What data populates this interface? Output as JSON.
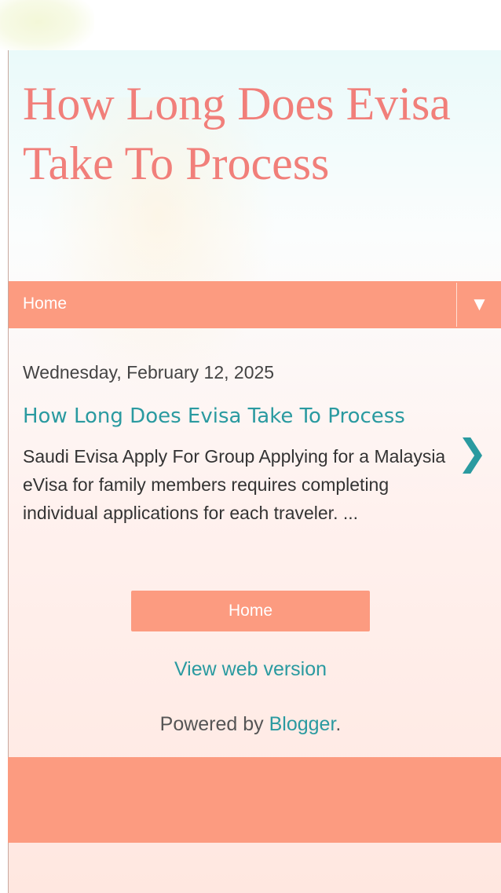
{
  "blog": {
    "title": "How Long Does Evisa Take To Process"
  },
  "nav": {
    "home_label": "Home",
    "menu_arrow": "▼"
  },
  "post": {
    "date": "Wednesday, February 12, 2025",
    "title": "How Long Does Evisa Take To Process",
    "snippet": "Saudi Evisa Apply For Group Applying for a Malaysia eVisa for family members requires completing individual applications for each traveler. ...",
    "next_arrow": "❯"
  },
  "footer": {
    "home_button_label": "Home",
    "web_version_label": "View web version",
    "powered_by_prefix": "Powered by ",
    "powered_by_link": "Blogger",
    "powered_by_suffix": "."
  },
  "colors": {
    "accent": "#fc9b80",
    "title": "#f17f7a",
    "link": "#2a9aa0"
  }
}
